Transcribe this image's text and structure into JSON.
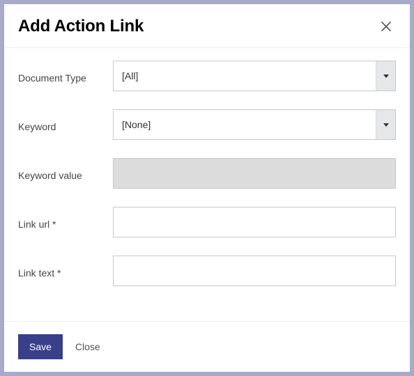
{
  "dialog": {
    "title": "Add Action Link"
  },
  "fields": {
    "documentType": {
      "label": "Document Type",
      "value": "[All]"
    },
    "keyword": {
      "label": "Keyword",
      "value": "[None]"
    },
    "keywordValue": {
      "label": "Keyword value",
      "value": ""
    },
    "linkUrl": {
      "label": "Link url *",
      "value": ""
    },
    "linkText": {
      "label": "Link text *",
      "value": ""
    }
  },
  "buttons": {
    "save": "Save",
    "close": "Close"
  }
}
